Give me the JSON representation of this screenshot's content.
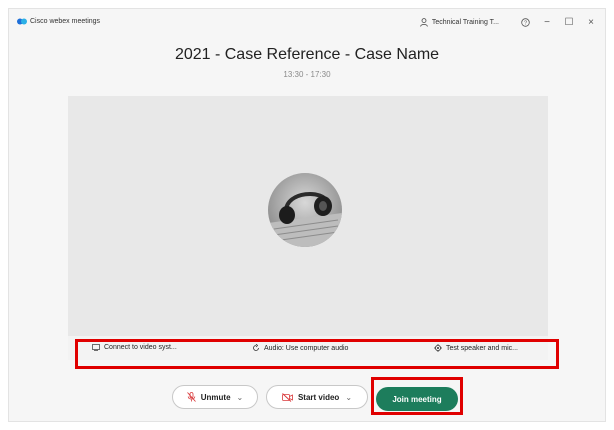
{
  "app": {
    "brand_name": "Cisco webex meetings"
  },
  "titlebar": {
    "account_label": "Technical Training T...",
    "help_icon": "help-icon",
    "minimize_glyph": "−",
    "maximize_glyph": "☐",
    "close_glyph": "×"
  },
  "meeting": {
    "title": "2021 - Case Reference - Case Name",
    "time": "13:30 - 17:30"
  },
  "options": {
    "connect_label": "Connect to video syst...",
    "audio_label": "Audio: Use computer audio",
    "test_label": "Test speaker and mic..."
  },
  "controls": {
    "unmute_label": "Unmute",
    "start_video_label": "Start video",
    "join_label": "Join meeting"
  },
  "colors": {
    "join_button": "#1d7d5c",
    "highlight_box": "#e00000",
    "mute_icon": "#d9383a"
  }
}
